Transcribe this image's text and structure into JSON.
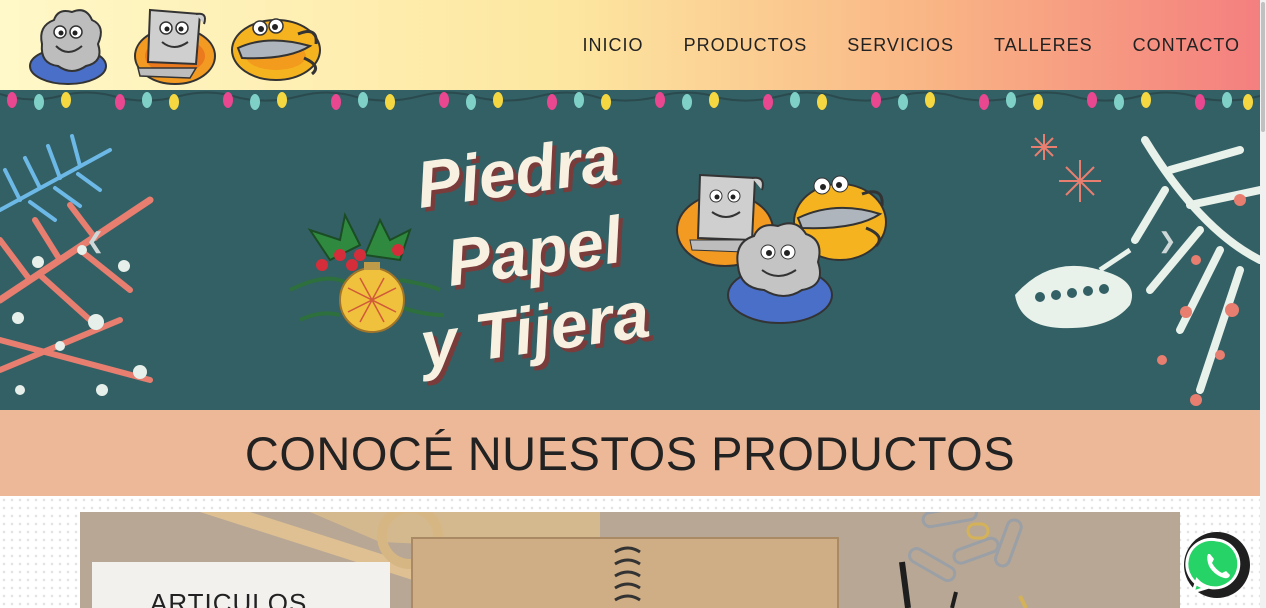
{
  "nav": {
    "items": [
      {
        "label": "INICIO"
      },
      {
        "label": "PRODUCTOS"
      },
      {
        "label": "SERVICIOS"
      },
      {
        "label": "TALLERES"
      },
      {
        "label": "CONTACTO"
      }
    ]
  },
  "banner": {
    "title_lines": [
      "Piedra",
      "Papel",
      "y Tijera"
    ],
    "prev_icon": "chevron-left-icon",
    "next_icon": "chevron-right-icon"
  },
  "section": {
    "heading": "CONOCÉ NUESTOS PRODUCTOS"
  },
  "products": {
    "card_label": "ARTICULOS"
  },
  "colors": {
    "banner_bg": "#336065",
    "heading_bg": "#ecb898",
    "whatsapp": "#25d366"
  }
}
